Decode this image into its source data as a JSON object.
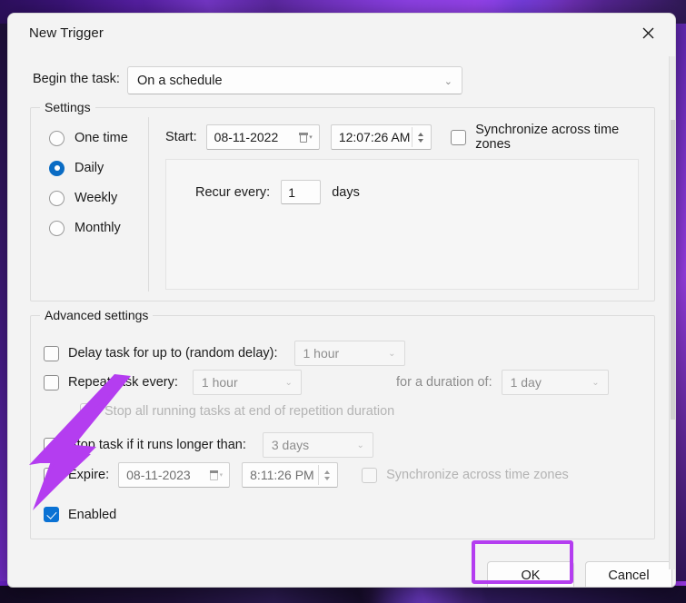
{
  "window": {
    "title": "New Trigger",
    "close_icon": "close-x-icon"
  },
  "begin_task": {
    "label": "Begin the task:",
    "selected": "On a schedule",
    "chevron": "⌄"
  },
  "settings": {
    "group_title": "Settings",
    "schedule_options": [
      {
        "label": "One time",
        "checked": false
      },
      {
        "label": "Daily",
        "checked": true
      },
      {
        "label": "Weekly",
        "checked": false
      },
      {
        "label": "Monthly",
        "checked": false
      }
    ],
    "start_label": "Start:",
    "start_date": "08-11-2022",
    "start_time": "12:07:26 AM",
    "sync_label": "Synchronize across time zones",
    "sync_checked": false,
    "recur_label": "Recur every:",
    "recur_value": "1",
    "recur_unit": "days"
  },
  "advanced": {
    "group_title": "Advanced settings",
    "delay_label": "Delay task for up to (random delay):",
    "delay_value": "1 hour",
    "delay_checked": false,
    "repeat_label": "Repeat task every:",
    "repeat_value": "1 hour",
    "repeat_checked": false,
    "duration_label": "for a duration of:",
    "duration_value": "1 day",
    "stop_all_label": "Stop all running tasks at end of repetition duration",
    "stop_all_checked": false,
    "stop_all_disabled": true,
    "stop_task_label": "Stop task if it runs longer than:",
    "stop_task_value": "3 days",
    "stop_task_checked": false,
    "expire_label": "Expire:",
    "expire_date": "08-11-2023",
    "expire_time": "8:11:26 PM",
    "expire_checked": false,
    "expire_sync_label": "Synchronize across time zones",
    "expire_sync_checked": false,
    "enabled_label": "Enabled",
    "enabled_checked": true
  },
  "footer": {
    "ok_label": "OK",
    "cancel_label": "Cancel"
  },
  "annotations": {
    "arrow_color": "#b43df0",
    "highlight_color": "#b43df0",
    "arrow_target": "enabled-checkbox",
    "highlight_target": "ok-button"
  }
}
